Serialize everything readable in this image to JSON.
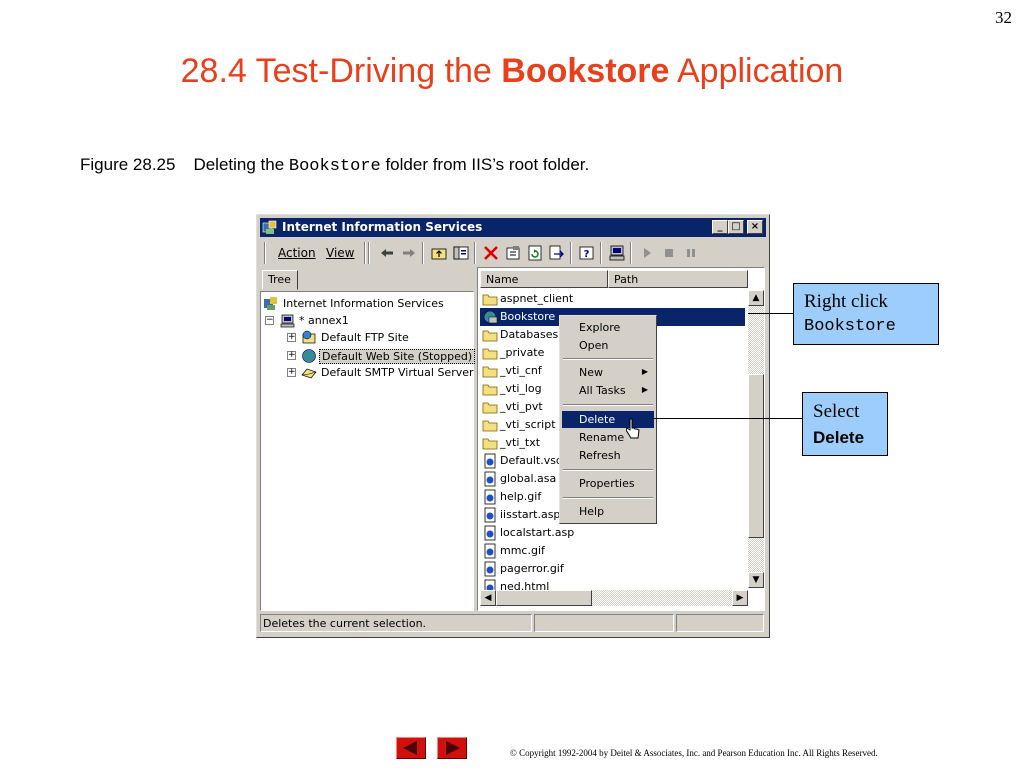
{
  "slide": {
    "page_number": "32",
    "title_part1": "28.4 Test-Driving the ",
    "title_bold": "Bookstore",
    "title_part2": " Application",
    "caption_label": "Figure 28.25",
    "caption_part1": "Deleting the ",
    "caption_code": "Bookstore",
    "caption_part2": " folder from IIS’s root folder.",
    "copyright": "© Copyright 1992-2004 by Deitel & Associates, Inc. and Pearson Education Inc. All Rights Reserved."
  },
  "window": {
    "title": "Internet Information Services",
    "controls": {
      "minimize": "_",
      "maximize": "□",
      "close": "×"
    },
    "menu": {
      "action": "Action",
      "view": "View"
    },
    "toolbar_icons": [
      "back-arrow-icon",
      "forward-arrow-icon",
      "up-folder-icon",
      "show-tree-icon",
      "delete-icon",
      "properties-icon",
      "refresh-icon",
      "export-icon",
      "help-icon",
      "computer-icon",
      "start-icon",
      "stop-icon",
      "pause-icon"
    ],
    "tree_tab": "Tree",
    "tree": {
      "root": "Internet Information Services",
      "server": "* annex1",
      "ftp": "Default FTP Site",
      "web": "Default Web Site (Stopped)",
      "smtp": "Default SMTP Virtual Server"
    },
    "columns": {
      "name": "Name",
      "path": "Path"
    },
    "list_items": [
      {
        "name": "aspnet_client",
        "icon": "folder-icon"
      },
      {
        "name": "Bookstore",
        "icon": "web-app-icon",
        "selected": true
      },
      {
        "name": "Databases",
        "icon": "folder-icon"
      },
      {
        "name": "_private",
        "icon": "folder-icon"
      },
      {
        "name": "_vti_cnf",
        "icon": "folder-icon"
      },
      {
        "name": "_vti_log",
        "icon": "folder-icon"
      },
      {
        "name": "_vti_pvt",
        "icon": "folder-icon"
      },
      {
        "name": "_vti_script",
        "icon": "folder-icon"
      },
      {
        "name": "_vti_txt",
        "icon": "folder-icon"
      },
      {
        "name": "Default.vsd",
        "icon": "file-icon"
      },
      {
        "name": "global.asa",
        "icon": "file-icon"
      },
      {
        "name": "help.gif",
        "icon": "file-icon"
      },
      {
        "name": "iisstart.asp",
        "icon": "file-icon"
      },
      {
        "name": "localstart.asp",
        "icon": "file-icon"
      },
      {
        "name": "mmc.gif",
        "icon": "file-icon"
      },
      {
        "name": "pagerror.gif",
        "icon": "file-icon"
      },
      {
        "name": "ned.html",
        "icon": "file-icon"
      }
    ],
    "status": "Deletes the current selection."
  },
  "context_menu": {
    "explore": "Explore",
    "open": "Open",
    "new": "New",
    "all_tasks": "All Tasks",
    "delete": "Delete",
    "rename": "Rename",
    "refresh": "Refresh",
    "properties": "Properties",
    "help": "Help",
    "submenu_arrow": "▶"
  },
  "callouts": {
    "right_click_line1": "Right click",
    "right_click_line2": "Bookstore",
    "select_line1": "Select",
    "select_line2": "Delete"
  },
  "colors": {
    "title": "#e8401c",
    "callout_bg": "#9ccdfb",
    "selection": "#0a246a",
    "nav_buttons": "#d0100b"
  }
}
